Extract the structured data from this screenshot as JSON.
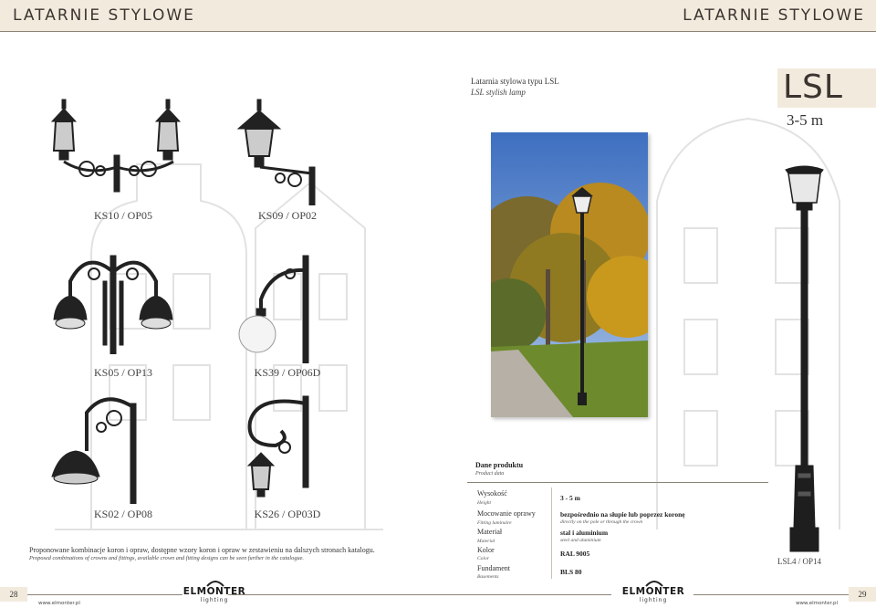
{
  "header": {
    "title_left": "LATARNIE STYLOWE",
    "title_right": "LATARNIE STYLOWE"
  },
  "combos": [
    {
      "code": "KS10 / OP05"
    },
    {
      "code": "KS09 / OP02"
    },
    {
      "code": "KS05 / OP13"
    },
    {
      "code": "KS39 / OP06D"
    },
    {
      "code": "KS02 / OP08"
    },
    {
      "code": "KS26 / OP03D"
    }
  ],
  "left_note": {
    "pl": "Proponowane kombinacje koron i opraw, dostępne wzory koron i opraw w zestawieniu na dalszych stronach katalogu.",
    "en": "Proposed combinations of crowns and fittings, available crown and fitting designs can be seen further in the catalogue."
  },
  "product": {
    "subtitle_pl": "Latarnia stylowa typu LSL",
    "subtitle_en": "LSL stylish lamp",
    "code": "LSL",
    "height": "3-5 m",
    "lamp_label": "LSL4 / OP14"
  },
  "specs": {
    "heading_pl": "Dane produktu",
    "heading_en": "Product data",
    "rows": [
      {
        "label_pl": "Wysokość",
        "label_en": "Height",
        "value_pl": "3 - 5 m",
        "value_en": ""
      },
      {
        "label_pl": "Mocowanie oprawy",
        "label_en": "Fitting luminaire",
        "value_pl": "bezpośrednio na słupie lub poprzez koronę",
        "value_en": "directly on the pole or through the crown"
      },
      {
        "label_pl": "Materiał",
        "label_en": "Material",
        "value_pl": "stal i aluminium",
        "value_en": "steel and aluminium"
      },
      {
        "label_pl": "Kolor",
        "label_en": "Color",
        "value_pl": "RAL 9005",
        "value_en": ""
      },
      {
        "label_pl": "Fundament",
        "label_en": "Basements",
        "value_pl": "BLS 80",
        "value_en": ""
      }
    ]
  },
  "footer": {
    "page_left": "28",
    "page_right": "29",
    "web_left": "www.elmonter.pl",
    "web_right": "www.elmonter.pl",
    "logo_name": "ELMONTER",
    "logo_sub": "lighting"
  },
  "colors": {
    "accent_bg": "#f2ebdd",
    "rule": "#8a8378",
    "ink": "#2b2b2b"
  }
}
